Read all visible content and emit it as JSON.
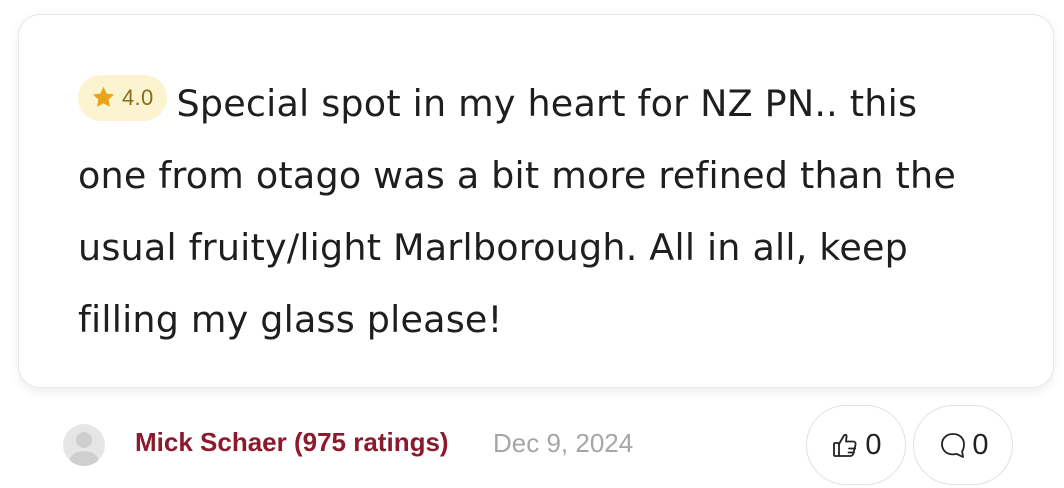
{
  "review": {
    "rating": "4.0",
    "text": "Special spot in my heart for NZ PN.. this one from otago was a bit more refined than the usual fruity/light Marlborough. All in all, keep filling my glass please!"
  },
  "reviewer": {
    "name_label": "Mick Schaer (975 ratings)",
    "date": "Dec 9, 2024"
  },
  "actions": {
    "likes": "0",
    "comments": "0"
  },
  "colors": {
    "accent": "#8b1a2d",
    "badge_bg": "#fcf3d0",
    "star": "#e8a316",
    "muted": "#a6a6a6"
  },
  "icons": {
    "rating": "star-icon",
    "like": "thumbs-up-icon",
    "comment": "comment-bubble-icon",
    "avatar": "avatar-placeholder-icon"
  }
}
